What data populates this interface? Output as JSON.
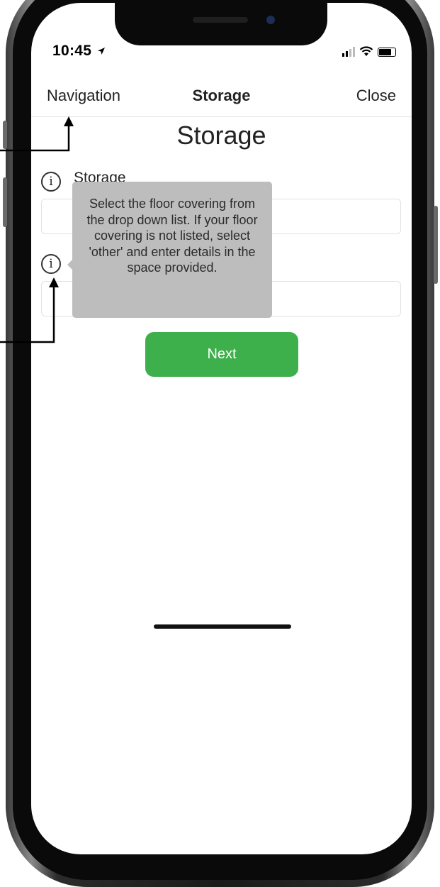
{
  "status_bar": {
    "time": "10:45"
  },
  "nav": {
    "left": "Navigation",
    "title": "Storage",
    "right": "Close"
  },
  "page": {
    "title": "Storage"
  },
  "form": {
    "field1_label": "Storage",
    "tooltip_text": "Select the floor covering from the drop down list. If your floor covering is not listed, select 'other' and enter details in the space provided.",
    "next_label": "Next"
  },
  "colors": {
    "primary_button": "#3db04c",
    "tooltip_bg": "#bdbdbd",
    "arrow": "#000000"
  }
}
